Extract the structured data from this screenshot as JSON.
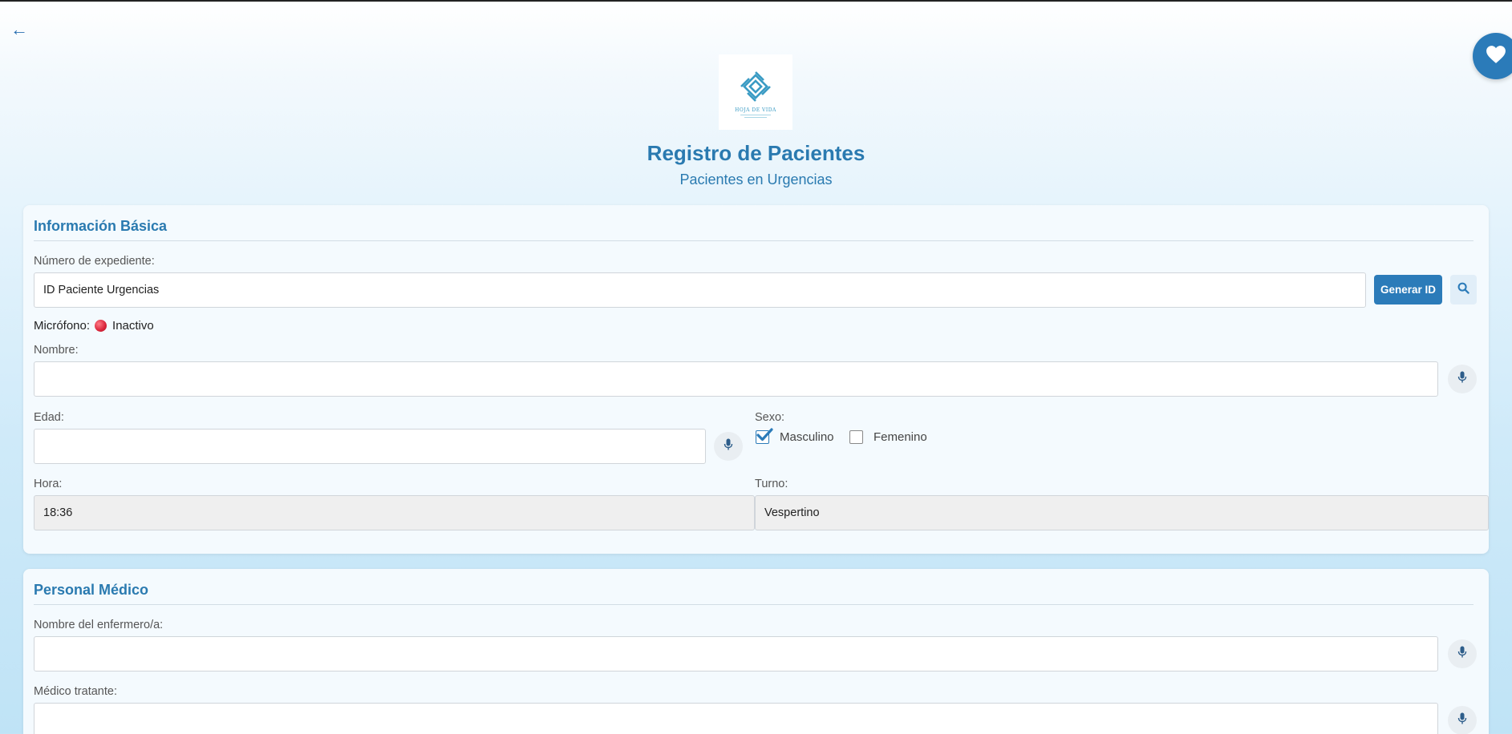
{
  "nav": {
    "back_icon": "←"
  },
  "fav": {
    "icon": "heart-icon"
  },
  "logo": {
    "text": "HOJA DE VIDA"
  },
  "header": {
    "title": "Registro de Pacientes",
    "subtitle": "Pacientes en Urgencias"
  },
  "basic_info": {
    "title": "Información Básica",
    "expediente": {
      "label": "Número de expediente:",
      "value": "ID Paciente Urgencias",
      "generate_button": "Generar ID"
    },
    "microphone": {
      "label": "Micrófono:",
      "status": "Inactivo",
      "status_color": "#d9243a"
    },
    "nombre": {
      "label": "Nombre:",
      "value": ""
    },
    "edad": {
      "label": "Edad:",
      "value": ""
    },
    "sexo": {
      "label": "Sexo:",
      "options": [
        {
          "label": "Masculino",
          "checked": true
        },
        {
          "label": "Femenino",
          "checked": false
        }
      ]
    },
    "hora": {
      "label": "Hora:",
      "value": "18:36"
    },
    "turno": {
      "label": "Turno:",
      "value": "Vespertino"
    }
  },
  "medical_staff": {
    "title": "Personal Médico",
    "enfermero": {
      "label": "Nombre del enfermero/a:",
      "value": ""
    },
    "medico": {
      "label": "Médico tratante:",
      "value": ""
    }
  },
  "colors": {
    "accent": "#2b7bb9",
    "title": "#2a7ab0"
  }
}
